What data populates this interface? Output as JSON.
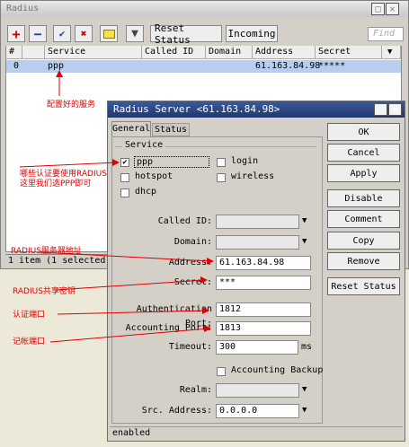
{
  "main": {
    "title": "Radius",
    "toolbar": {
      "reset_status": "Reset Status",
      "incoming": "Incoming",
      "find_placeholder": "Find"
    },
    "columns": [
      "#",
      "Service",
      "Called ID",
      "Domain",
      "Address",
      "Secret"
    ],
    "row": {
      "num": "0",
      "service": "ppp",
      "called_id": "",
      "domain": "",
      "address": "61.163.84.98",
      "secret": "*****"
    },
    "status": "1 item (1 selected)"
  },
  "dialog": {
    "title": "Radius Server <61.163.84.98>",
    "tabs": {
      "general": "General",
      "status": "Status"
    },
    "service_group": "Service",
    "services": {
      "ppp": "ppp",
      "login": "login",
      "hotspot": "hotspot",
      "wireless": "wireless",
      "dhcp": "dhcp"
    },
    "labels": {
      "called_id": "Called ID:",
      "domain": "Domain:",
      "address": "Address:",
      "secret": "Secret:",
      "auth_port": "Authentication Port:",
      "acct_port": "Accounting Port:",
      "timeout": "Timeout:",
      "acct_backup": "Accounting Backup",
      "realm": "Realm:",
      "src_address": "Src. Address:"
    },
    "values": {
      "address": "61.163.84.98",
      "secret": "***",
      "auth_port": "1812",
      "acct_port": "1813",
      "timeout": "300",
      "timeout_unit": "ms",
      "src_address": "0.0.0.0"
    },
    "buttons": {
      "ok": "OK",
      "cancel": "Cancel",
      "apply": "Apply",
      "disable": "Disable",
      "comment": "Comment",
      "copy": "Copy",
      "remove": "Remove",
      "reset_status": "Reset Status"
    },
    "status": "enabled"
  },
  "annotations": {
    "configured": "配置好的服务",
    "which_auth": "哪些认证要使用RADIUS",
    "choose_ppp": "这里我们选PPP即可",
    "server_addr": "RADIUS服务器地址",
    "shared_secret": "RADIUS共享密钥",
    "auth_port": "认证端口",
    "acct_port": "记帐端口"
  },
  "colors": {
    "annotation": "#e00000",
    "selected_row": "#b8cdf0",
    "dialog_title": "#21386f"
  }
}
